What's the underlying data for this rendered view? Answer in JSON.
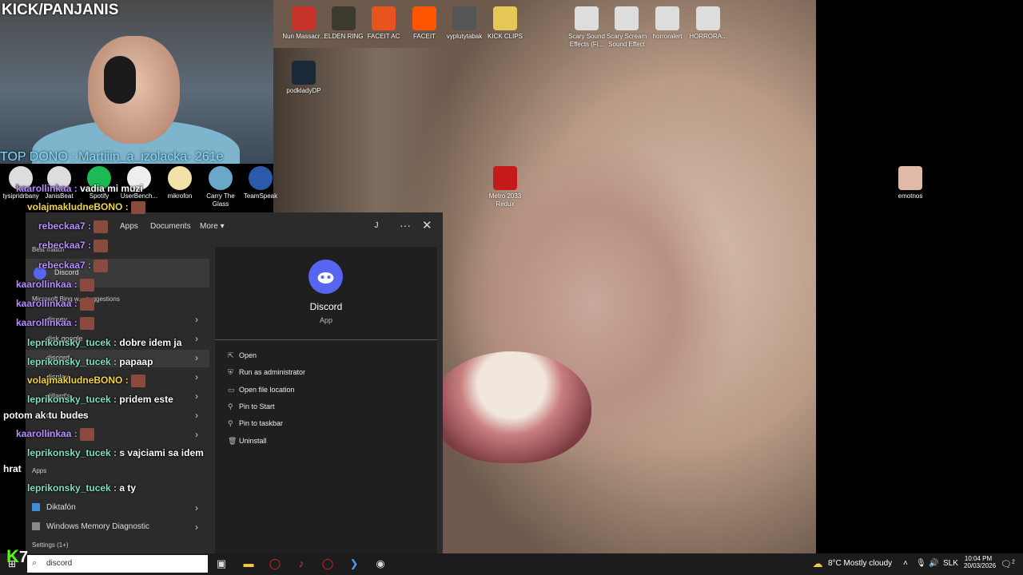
{
  "stream": {
    "brand": "KICK/PANJANIS",
    "top_dono": "TOP DONO : Martiiin_a_izolacka- 261e",
    "kick_logo": "K",
    "kick_logo_number": "7"
  },
  "desktop_icons": [
    {
      "label": "Nun Massacr...",
      "color": "#c8342b",
      "icon": "winrar-icon"
    },
    {
      "label": "ELDEN RING",
      "color": "#3c3a2c",
      "icon": "elden-ring-icon"
    },
    {
      "label": "FACEIT AC",
      "color": "#e8541e",
      "icon": "faceit-ac-icon"
    },
    {
      "label": "FACEIT",
      "color": "#ff5500",
      "icon": "faceit-icon"
    },
    {
      "label": "vyplutytabak",
      "color": "#555",
      "icon": "video-icon"
    },
    {
      "label": "KICK CLIPS",
      "color": "#e4c659",
      "icon": "folder-icon"
    },
    {
      "label": "Scary Sound Effects (Fi...",
      "color": "#ddd",
      "icon": "media-icon"
    },
    {
      "label": "Scary Scream Sound Effect",
      "color": "#ddd",
      "icon": "media-icon"
    },
    {
      "label": "horroralert",
      "color": "#ddd",
      "icon": "media-icon"
    },
    {
      "label": "HORRORA...",
      "color": "#ddd",
      "icon": "media-icon"
    },
    {
      "label": "podkladyDP",
      "color": "#1b2838",
      "icon": "steam-icon"
    },
    {
      "label": "Metro 2033 Redux",
      "color": "#c41a1a",
      "icon": "metro-icon"
    },
    {
      "label": "emotnos",
      "color": "#e0b9a7",
      "icon": "image-icon"
    }
  ],
  "left_icons": [
    {
      "label": "tysipridrbany",
      "icon": "media-icon"
    },
    {
      "label": "JanisBeat",
      "icon": "media-icon"
    },
    {
      "label": "Spotify",
      "icon": "spotify-icon"
    },
    {
      "label": "UserBench...",
      "icon": "gauge-icon"
    },
    {
      "label": "mikrofon",
      "icon": "document-icon"
    },
    {
      "label": "Carry The Glass",
      "icon": "game-icon"
    },
    {
      "label": "TeamSpeak",
      "icon": "teamspeak-icon"
    }
  ],
  "start_menu": {
    "tabs": [
      "Apps",
      "Documents",
      "More"
    ],
    "user_initial": "J",
    "best_match_label": "Best match",
    "best_match_item": "Discord",
    "web_suggestions_label": "Microsoft Bing w... suggestions",
    "web_items": [
      "disney",
      "disk google",
      "discord",
      "display",
      "dillard's",
      "di... ...ement",
      "di... ...s"
    ],
    "apps_label": "Apps",
    "apps": [
      "Diktafón",
      "Windows Memory Diagnostic"
    ],
    "settings_label": "Settings (1+)",
    "detail": {
      "app_name": "Discord",
      "app_type": "App",
      "actions": [
        {
          "label": "Open",
          "icon": "open-icon"
        },
        {
          "label": "Run as administrator",
          "icon": "admin-icon"
        },
        {
          "label": "Open file location",
          "icon": "folder-location-icon"
        },
        {
          "label": "Pin to Start",
          "icon": "pin-icon"
        },
        {
          "label": "Pin to taskbar",
          "icon": "pin-icon"
        },
        {
          "label": "Uninstall",
          "icon": "trash-icon"
        }
      ]
    }
  },
  "chat": [
    {
      "user": "kaarollinkaa :",
      "msg": "vadia mi muzi",
      "style": "purple"
    },
    {
      "user": "volajmakludneBONO :",
      "msg": "",
      "style": "yellow"
    },
    {
      "user": "rebeckaa7 :",
      "msg": "",
      "style": "purple"
    },
    {
      "user": "rebeckaa7 :",
      "msg": "",
      "style": "purple"
    },
    {
      "user": "rebeckaa7 :",
      "msg": "",
      "style": "purple"
    },
    {
      "user": "kaarollinkaa :",
      "msg": "",
      "style": "purple"
    },
    {
      "user": "kaarollinkaa :",
      "msg": "",
      "style": "purple"
    },
    {
      "user": "kaarollinkaa :",
      "msg": "",
      "style": "purple"
    },
    {
      "user": "leprikonsky_tucek :",
      "msg": "dobre idem ja",
      "style": "green"
    },
    {
      "user": "leprikonsky_tucek :",
      "msg": "papaap",
      "style": "green"
    },
    {
      "user": "volajmakludneBONO :",
      "msg": "",
      "style": "yellow"
    },
    {
      "user": "leprikonsky_tucek :",
      "msg": "pridem este",
      "style": "green"
    },
    {
      "user": "",
      "msg": "potom ak tu budes",
      "style": "none"
    },
    {
      "user": "kaarollinkaa :",
      "msg": "",
      "style": "purple"
    },
    {
      "user": "leprikonsky_tucek :",
      "msg": "s vajciami sa idem",
      "style": "green"
    },
    {
      "user": "",
      "msg": "hrat",
      "style": "none"
    },
    {
      "user": "leprikonsky_tucek :",
      "msg": "a ty",
      "style": "green"
    }
  ],
  "taskbar": {
    "search_value": "discord",
    "weather": "8°C  Mostly cloudy",
    "lang": "SLK",
    "time": "10:04 PM",
    "date": "20/03/2026",
    "notif_count": "2"
  },
  "colors": {
    "accent": "#5865f2",
    "menu_bg": "#2b2b2b"
  }
}
